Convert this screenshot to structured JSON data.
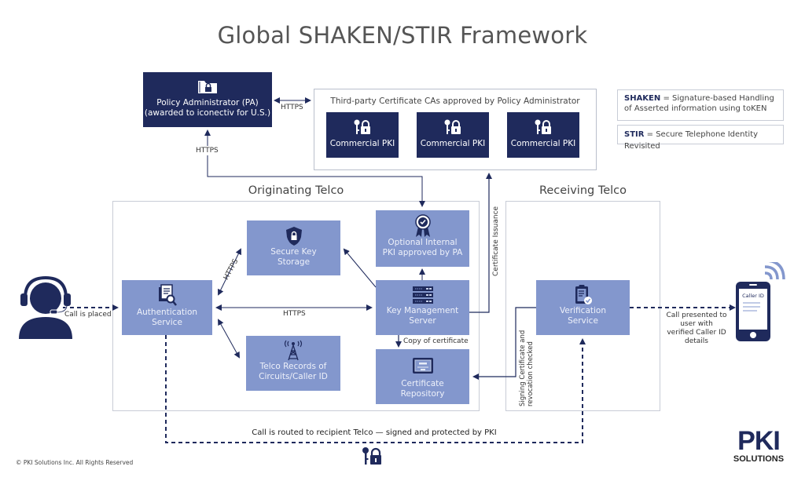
{
  "title": "Global SHAKEN/STIR Framework",
  "policy_admin": {
    "line1": "Policy Administrator (PA)",
    "line2": "(awarded to iconectiv for U.S.)",
    "icon": "folder-lock-icon"
  },
  "third_party": {
    "title": "Third-party Certificate CAs approved by Policy Administrator",
    "items": [
      {
        "label": "Commercial PKI",
        "icon": "key-lock-icon"
      },
      {
        "label": "Commercial PKI",
        "icon": "key-lock-icon"
      },
      {
        "label": "Commercial PKI",
        "icon": "key-lock-icon"
      }
    ]
  },
  "legend": {
    "shaken_abbr": "SHAKEN",
    "shaken_def_1": " = Signature-based Handling",
    "shaken_def_2": "of Asserted information using toKEN",
    "stir_abbr": "STIR",
    "stir_def": " = Secure Telephone Identity Revisited"
  },
  "sections": {
    "originating": "Originating Telco",
    "receiving": "Receiving Telco"
  },
  "boxes": {
    "auth": {
      "line1": "Authentication",
      "line2": "Service",
      "icon": "document-search-icon"
    },
    "secure_key": {
      "line1": "Secure Key",
      "line2": "Storage",
      "icon": "shield-lock-icon"
    },
    "telco_records": {
      "line1": "Telco Records of",
      "line2": "Circuits/Caller ID",
      "icon": "antenna-tower-icon"
    },
    "internal_pki": {
      "line1": "Optional Internal",
      "line2": "PKI approved by PA",
      "icon": "award-ribbon-icon"
    },
    "kms": {
      "line1": "Key Management",
      "line2": "Server",
      "icon": "server-rack-icon"
    },
    "cert_repo": {
      "line1": "Certificate",
      "line2": "Repository",
      "icon": "certificate-icon"
    },
    "verification": {
      "line1": "Verification",
      "line2": "Service",
      "icon": "clipboard-check-icon"
    }
  },
  "labels": {
    "https_pa_ca": "HTTPS",
    "https_pa_down": "HTTPS",
    "https_auth_kms": "HTTPS",
    "https_auth_secure": "HTTPS",
    "call_placed": "Call is placed",
    "copy_cert": "Copy of certificate",
    "cert_issuance": "Certificate Issuance",
    "signing_check_1": "Signing Certificate and",
    "signing_check_2": "revocation checked",
    "call_presented_1": "Call presented to",
    "call_presented_2": "user with",
    "call_presented_3": "verified Caller ID",
    "call_presented_4": "details",
    "routed": "Call is routed to recipient Telco — signed and protected by PKI",
    "phone_caller_id": "Caller ID"
  },
  "footer": {
    "copyright": "© PKI Solutions Inc. All Rights Reserved",
    "logo_top": "PKI",
    "logo_bottom": "SOLUTIONS"
  },
  "colors": {
    "dark_navy": "#1f2a5c",
    "light_blue": "#8397cd",
    "frame_gray": "#b9bfcc"
  }
}
